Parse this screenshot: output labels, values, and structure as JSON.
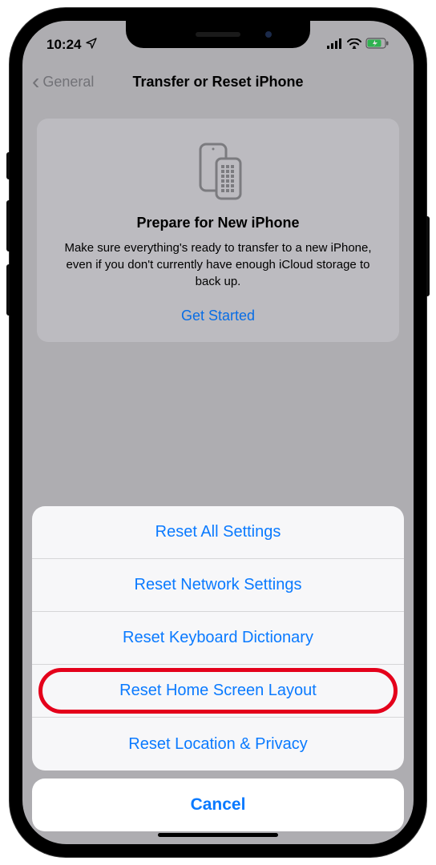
{
  "status": {
    "time": "10:24"
  },
  "nav": {
    "back_label": "General",
    "title": "Transfer or Reset iPhone"
  },
  "card": {
    "title": "Prepare for New iPhone",
    "body": "Make sure everything's ready to transfer to a new iPhone, even if you don't currently have enough iCloud storage to back up.",
    "cta": "Get Started"
  },
  "sheet": {
    "items": [
      "Reset All Settings",
      "Reset Network Settings",
      "Reset Keyboard Dictionary",
      "Reset Home Screen Layout",
      "Reset Location & Privacy"
    ],
    "highlighted_index": 3,
    "cancel": "Cancel"
  }
}
